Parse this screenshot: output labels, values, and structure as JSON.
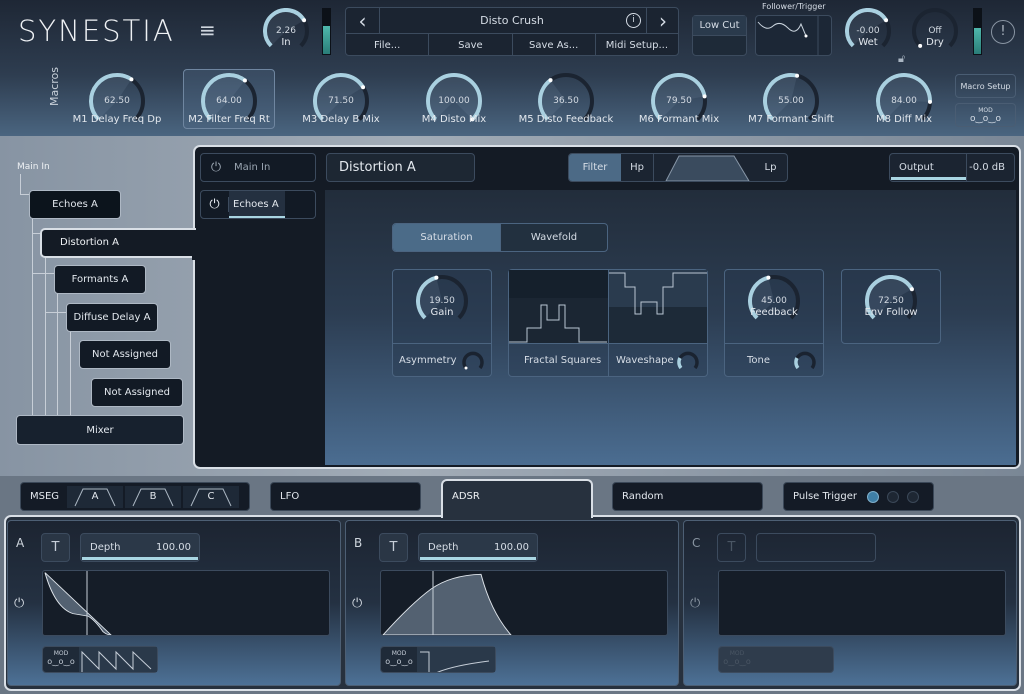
{
  "header": {
    "logo": "SYNESTIA",
    "menu_icon": "hamburger-icon",
    "input_knob": {
      "value": "2.26",
      "label": "In",
      "fill": 0.72
    },
    "preset": {
      "name": "Disto Crush",
      "prev": "‹",
      "next": "›",
      "info_icon": "info-icon",
      "buttons": [
        "File...",
        "Save",
        "Save As...",
        "Midi Setup..."
      ]
    },
    "low_cut": "Low Cut",
    "follower_label": "Follower/Trigger",
    "wet": {
      "value": "-0.00",
      "label": "Wet",
      "fill": 0.72
    },
    "dry": {
      "value": "Off",
      "label": "Dry",
      "fill": 0.0
    },
    "alert": "!"
  },
  "macros": {
    "label": "Macros",
    "items": [
      {
        "value": "62.50",
        "label": "M1 Delay Freq Dp",
        "fill": 0.625
      },
      {
        "value": "64.00",
        "label": "M2 Filter Freq Rt",
        "fill": 0.64
      },
      {
        "value": "71.50",
        "label": "M3 Delay B Mix",
        "fill": 0.715
      },
      {
        "value": "100.00",
        "label": "M4 Disto Mix",
        "fill": 1.0
      },
      {
        "value": "36.50",
        "label": "M5 Disto Feedback",
        "fill": 0.365
      },
      {
        "value": "79.50",
        "label": "M6 Formant Mix",
        "fill": 0.795
      },
      {
        "value": "55.00",
        "label": "M7 Formant Shift",
        "fill": 0.55
      },
      {
        "value": "84.00",
        "label": "M8 Diff Mix",
        "fill": 0.84
      }
    ],
    "setup": "Macro Setup",
    "mod": "MOD"
  },
  "routing": {
    "main_in": "Main In",
    "nodes": [
      "Echoes A",
      "Distortion A",
      "Formants A",
      "Diffuse Delay A",
      "Not Assigned",
      "Not Assigned",
      "Mixer"
    ]
  },
  "slots": [
    "Main In",
    "Echoes A"
  ],
  "module": {
    "title": "Distortion A",
    "filter": "Filter",
    "hp": "Hp",
    "lp": "Lp",
    "output": "Output",
    "output_value": "-0.0 dB",
    "modes": [
      "Saturation",
      "Wavefold"
    ],
    "gain": {
      "value": "19.50",
      "label": "Gain",
      "fill": 0.45
    },
    "asymmetry": "Asymmetry",
    "fractal": "Fractal Squares",
    "waveshape": "Waveshape",
    "feedback": {
      "value": "45.00",
      "label": "Feedback",
      "fill": 0.45
    },
    "tone": "Tone",
    "env_follow": {
      "value": "72.50",
      "label": "Env Follow",
      "fill": 0.725
    }
  },
  "mod_tabs": {
    "mseg": "MSEG",
    "mseg_slots": [
      "A",
      "B",
      "C"
    ],
    "lfo": "LFO",
    "adsr": "ADSR",
    "random": "Random",
    "pulse": "Pulse Trigger"
  },
  "adsr": [
    {
      "name": "A",
      "t": "T",
      "depth_label": "Depth",
      "depth": "100.00"
    },
    {
      "name": "B",
      "t": "T",
      "depth_label": "Depth",
      "depth": "100.00"
    },
    {
      "name": "C",
      "t": "T"
    }
  ]
}
